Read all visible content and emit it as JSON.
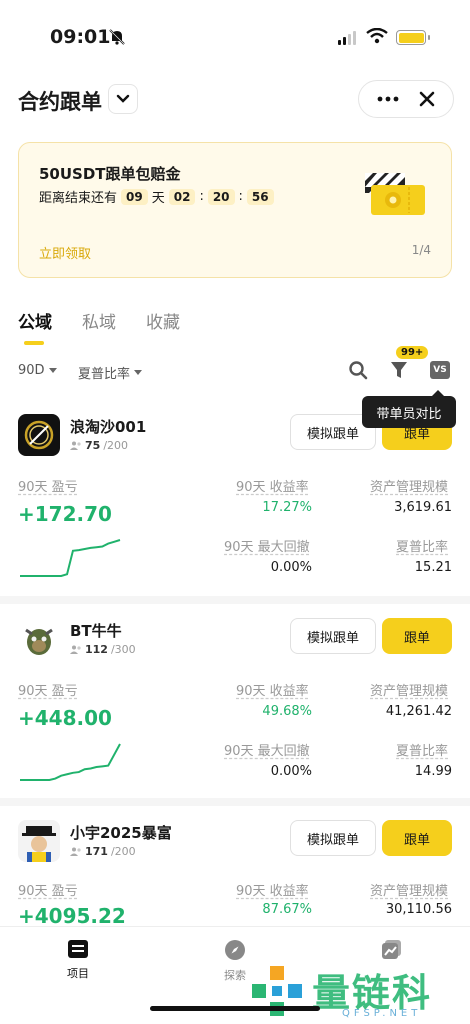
{
  "status_bar": {
    "time": "09:01"
  },
  "header": {
    "title": "合约跟单"
  },
  "banner": {
    "title": "50USDT跟单包赔金",
    "countdown_label": "距离结束还有",
    "days": "09",
    "days_unit": "天",
    "hours": "02",
    "minutes": "20",
    "seconds": "56",
    "sep": ":",
    "claim": "立即领取",
    "pager": "1/4"
  },
  "tabs": [
    {
      "label": "公域",
      "active": true
    },
    {
      "label": "私域",
      "active": false
    },
    {
      "label": "收藏",
      "active": false
    }
  ],
  "filters": {
    "period": "90D",
    "sort": "夏普比率",
    "badge": "99+",
    "vs": "VS",
    "tooltip": "带单员对比"
  },
  "labels": {
    "pnl": "90天 盈亏",
    "roi": "90天 收益率",
    "aum": "资产管理规模",
    "mdd": "90天 最大回撤",
    "sharpe": "夏普比率",
    "sim_button": "模拟跟单",
    "follow_button": "跟单"
  },
  "traders": [
    {
      "name": "浪淘沙001",
      "followers": "75",
      "capacity": "/200",
      "pnl": "+172.70",
      "roi": "17.27%",
      "aum": "3,619.61",
      "mdd": "0.00%",
      "sharpe": "15.21",
      "spark": [
        0,
        0,
        0,
        0,
        0,
        0,
        0,
        0,
        0.05,
        0.7,
        0.72,
        0.75,
        0.78,
        0.8,
        0.82,
        0.9,
        0.95,
        1
      ]
    },
    {
      "name": "BT牛牛",
      "followers": "112",
      "capacity": "/300",
      "pnl": "+448.00",
      "roi": "49.68%",
      "aum": "41,261.42",
      "mdd": "0.00%",
      "sharpe": "14.99",
      "spark": [
        0,
        0,
        0,
        0,
        0,
        0,
        0.04,
        0.12,
        0.16,
        0.2,
        0.22,
        0.3,
        0.32,
        0.36,
        0.38,
        0.4,
        0.7,
        1
      ]
    },
    {
      "name": "小宇2025暴富",
      "followers": "171",
      "capacity": "/200",
      "pnl": "+4095.22",
      "roi": "87.67%",
      "aum": "30,110.56"
    }
  ],
  "bottom_nav": [
    {
      "label": "项目",
      "icon": "list-icon",
      "active": true
    },
    {
      "label": "探索",
      "icon": "compass-icon",
      "active": false
    },
    {
      "label": "",
      "icon": "chart-icon",
      "active": false
    }
  ],
  "watermark": {
    "text": "量链科技",
    "sub": "QFSP.NET"
  },
  "colors": {
    "accent": "#f5cf1c",
    "profit": "#20b26c"
  }
}
